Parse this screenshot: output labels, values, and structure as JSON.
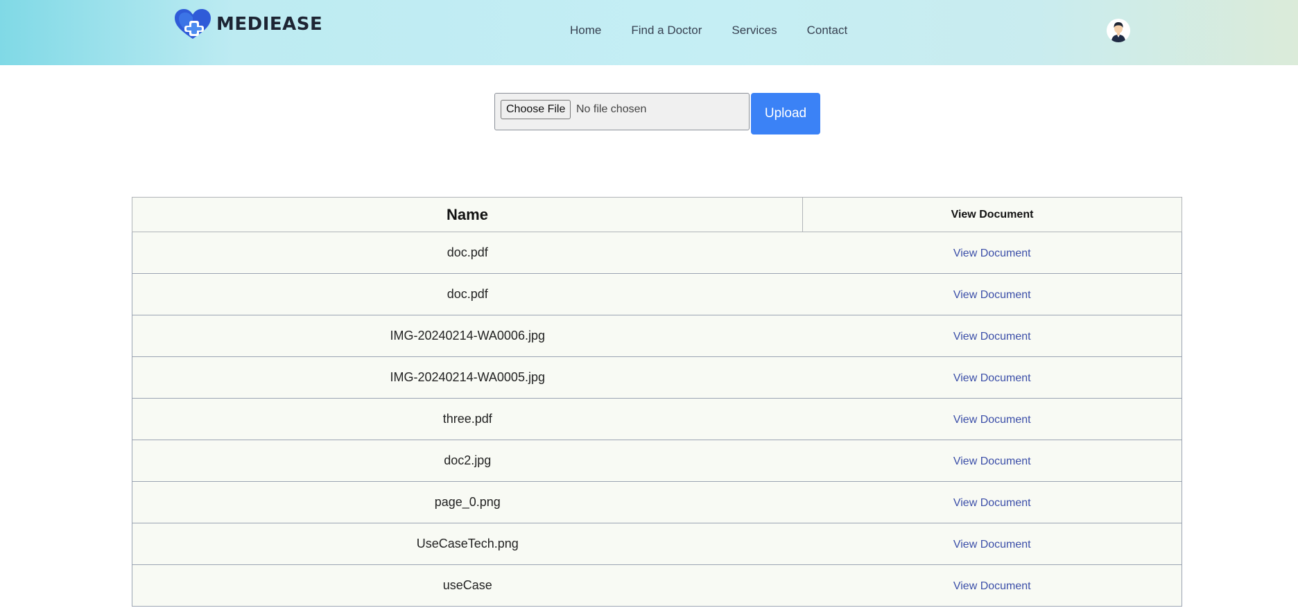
{
  "header": {
    "brand": "MEDIEASE",
    "nav": [
      {
        "label": "Home"
      },
      {
        "label": "Find a Doctor"
      },
      {
        "label": "Services"
      },
      {
        "label": "Contact"
      }
    ],
    "avatar_icon": "user-avatar-icon"
  },
  "upload": {
    "choose_label": "Choose File",
    "status": "No file chosen",
    "upload_label": "Upload",
    "accent_color": "#3b82f6"
  },
  "table": {
    "headers": {
      "name": "Name",
      "view": "View Document"
    },
    "rows": [
      {
        "name": "doc.pdf",
        "link": "View Document"
      },
      {
        "name": "doc.pdf",
        "link": "View Document"
      },
      {
        "name": "IMG-20240214-WA0006.jpg",
        "link": "View Document"
      },
      {
        "name": "IMG-20240214-WA0005.jpg",
        "link": "View Document"
      },
      {
        "name": "three.pdf",
        "link": "View Document"
      },
      {
        "name": "doc2.jpg",
        "link": "View Document"
      },
      {
        "name": "page_0.png",
        "link": "View Document"
      },
      {
        "name": "UseCaseTech.png",
        "link": "View Document"
      },
      {
        "name": "useCase",
        "link": "View Document"
      }
    ]
  }
}
